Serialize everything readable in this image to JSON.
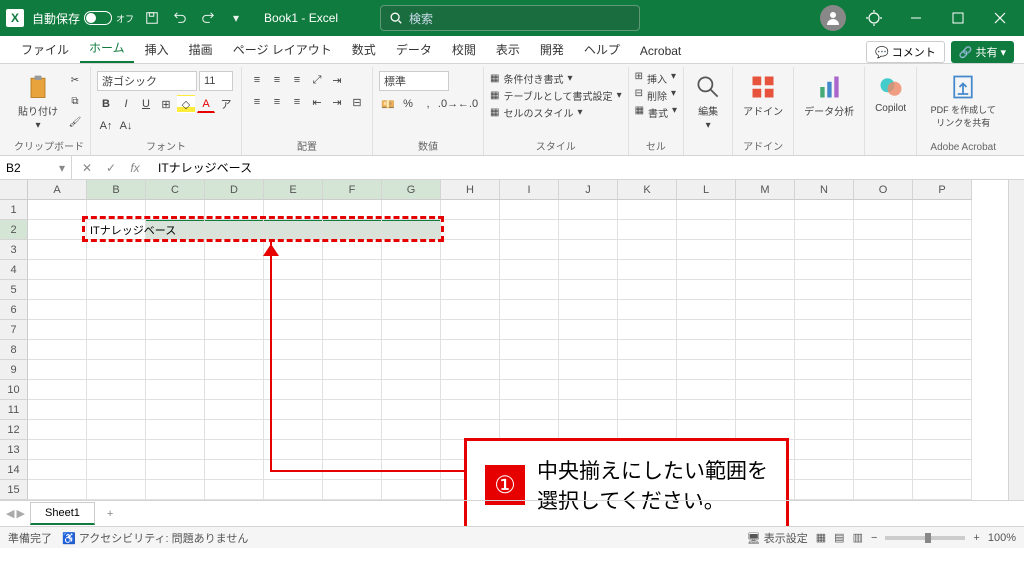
{
  "titlebar": {
    "autosave": "自動保存",
    "autosave_state": "オフ",
    "title": "Book1 - Excel",
    "search": "検索"
  },
  "tabs": {
    "items": [
      "ファイル",
      "ホーム",
      "挿入",
      "描画",
      "ページ レイアウト",
      "数式",
      "データ",
      "校閲",
      "表示",
      "開発",
      "ヘルプ",
      "Acrobat"
    ],
    "comment": "コメント",
    "share": "共有"
  },
  "ribbon": {
    "clipboard": {
      "paste": "貼り付け",
      "label": "クリップボード"
    },
    "font": {
      "name": "游ゴシック",
      "size": "11",
      "label": "フォント"
    },
    "align": {
      "label": "配置"
    },
    "number": {
      "format": "標準",
      "label": "数値"
    },
    "styles": {
      "cond": "条件付き書式",
      "table": "テーブルとして書式設定",
      "cell": "セルのスタイル",
      "label": "スタイル"
    },
    "cells": {
      "insert": "挿入",
      "delete": "削除",
      "format": "書式",
      "label": "セル"
    },
    "editing": {
      "label": "編集"
    },
    "addins": {
      "btn": "アドイン",
      "label": "アドイン"
    },
    "data": {
      "btn": "データ分析"
    },
    "copilot": {
      "btn": "Copilot"
    },
    "acrobat": {
      "btn": "PDF を作成してリンクを共有",
      "label": "Adobe Acrobat"
    }
  },
  "formula": {
    "ref": "B2",
    "value": "ITナレッジベース"
  },
  "grid": {
    "cols": [
      "A",
      "B",
      "C",
      "D",
      "E",
      "F",
      "G",
      "H",
      "I",
      "J",
      "K",
      "L",
      "M",
      "N",
      "O",
      "P"
    ],
    "b2": "ITナレッジベース"
  },
  "annotation": {
    "num": "①",
    "text1": "中央揃えにしたい範囲を",
    "text2": "選択してください。"
  },
  "sheets": {
    "name": "Sheet1"
  },
  "status": {
    "ready": "準備完了",
    "access": "アクセシビリティ: 問題ありません",
    "display": "表示設定",
    "zoom": "100%"
  }
}
